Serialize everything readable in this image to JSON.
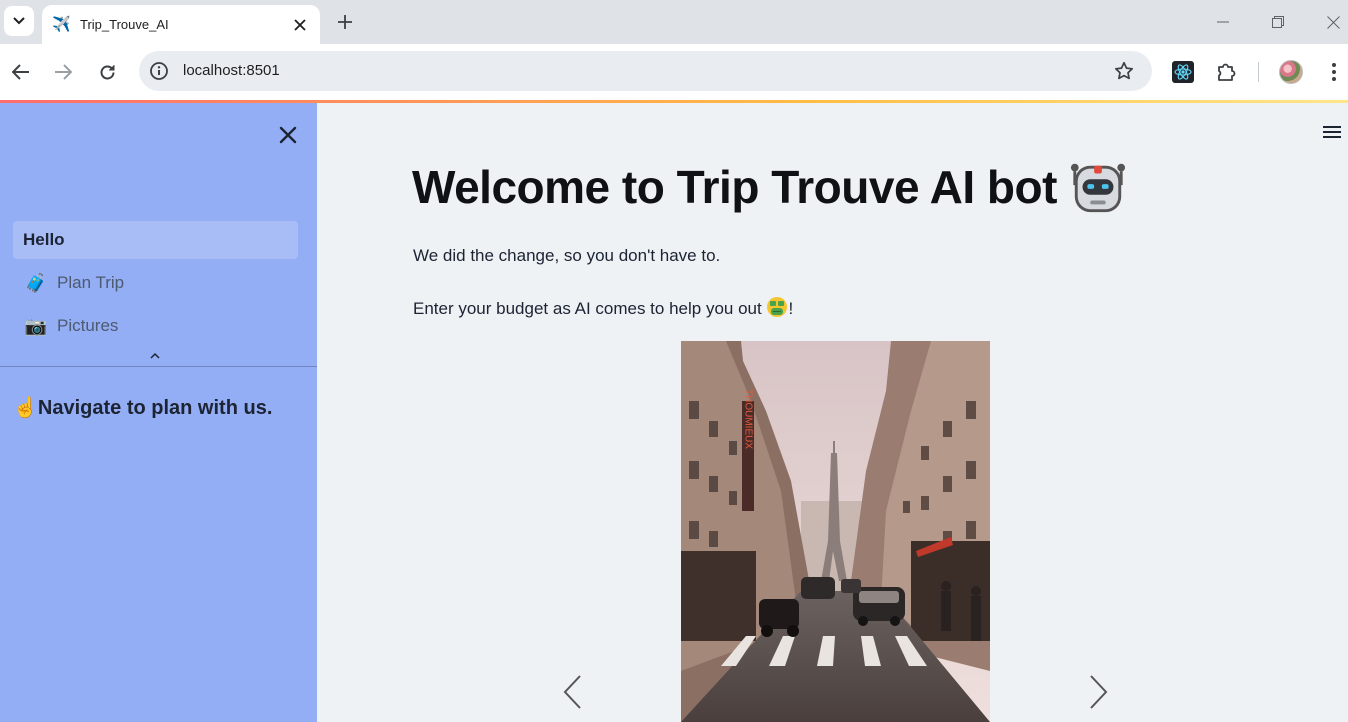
{
  "browser": {
    "tab_title": "Trip_Trouve_AI",
    "tab_favicon": "✈️",
    "url": "localhost:8501"
  },
  "sidebar": {
    "items": [
      {
        "label": "Hello",
        "emoji": "",
        "active": true
      },
      {
        "label": "Plan Trip",
        "emoji": "🧳",
        "active": false
      },
      {
        "label": "Pictures",
        "emoji": "📷",
        "active": false
      }
    ],
    "note_emoji": "☝️",
    "note_text": "Navigate to plan with us."
  },
  "main": {
    "title": "Welcome to Trip Trouve AI bot",
    "title_icon": "robot-face-icon",
    "line1": "We did the change, so you don't have to.",
    "line2_text": "Enter your budget as AI comes to help you out",
    "line2_icon": "money-mouth-face-icon",
    "line2_suffix": "!",
    "carousel": {
      "image": "paris-street-eiffel-tower",
      "sign_text": "THOUMIEUX"
    }
  },
  "colors": {
    "sidebar_bg": "#93aef4",
    "main_bg": "#eff2f5",
    "active_item_bg": "#a8bdf6"
  }
}
